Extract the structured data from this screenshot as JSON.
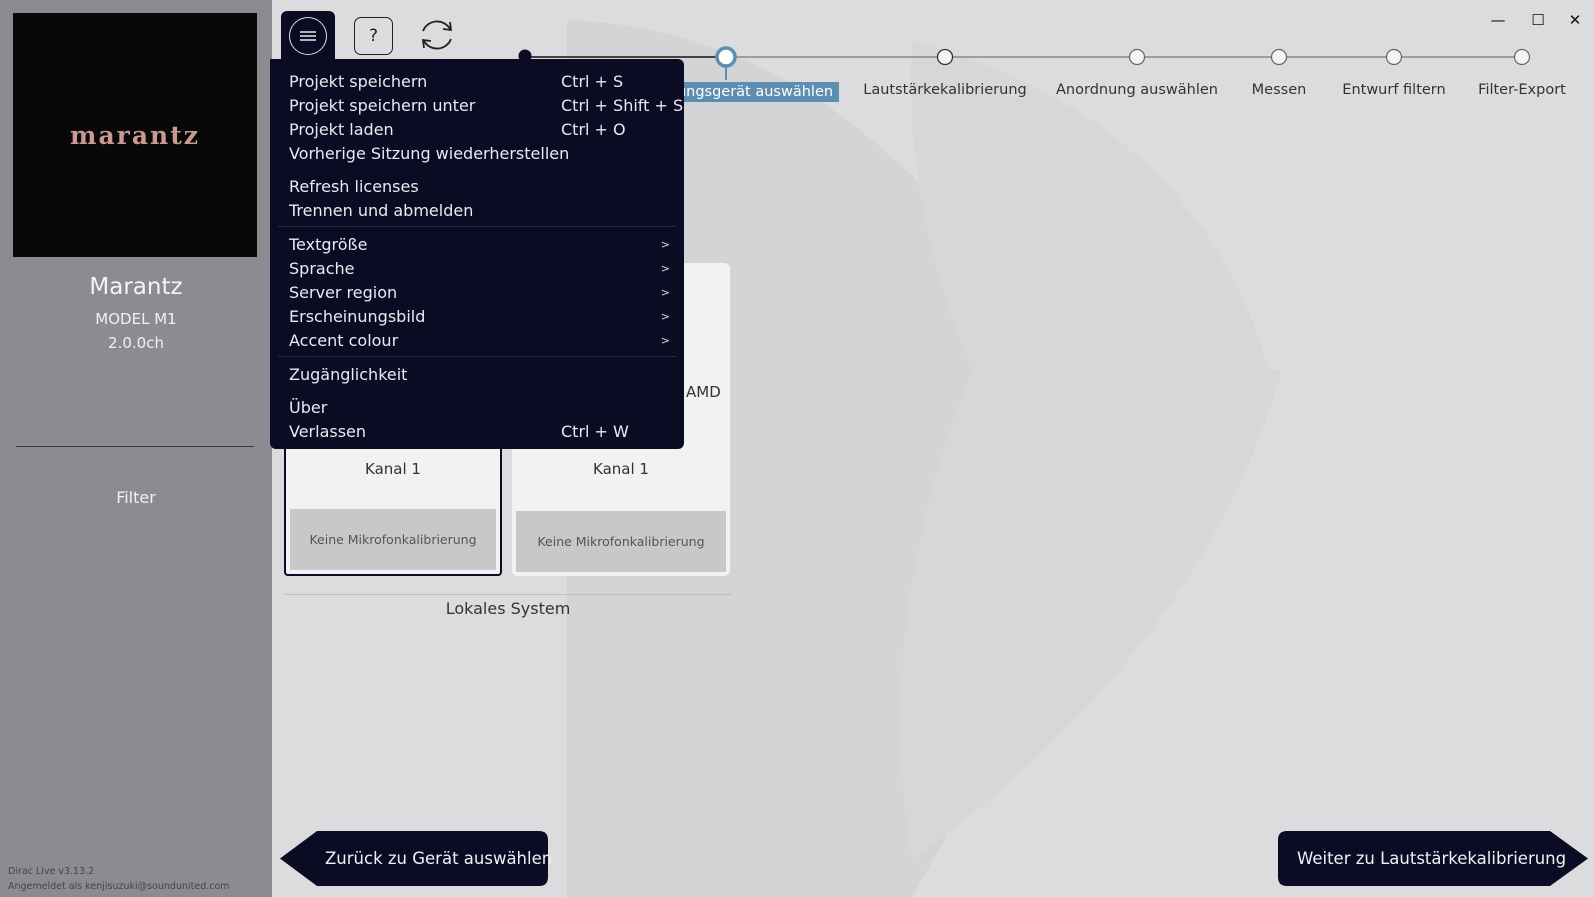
{
  "sidebar": {
    "brand_logo": "marantz",
    "device_name": "Marantz",
    "device_model": "MODEL M1",
    "device_channels": "2.0.0ch",
    "filter_label": "Filter",
    "version": "Dirac Live v3.13.2",
    "signed_in": "Angemeldet als kenjisuzuki@soundunited.com"
  },
  "toolbar": {
    "menu_icon": "hamburger-icon",
    "help_glyph": "?",
    "refresh_icon": "refresh-icon"
  },
  "window_controls": {
    "minimize": "—",
    "maximize": "☐",
    "close": "✕"
  },
  "steps": [
    {
      "label": "",
      "state": "done"
    },
    {
      "label": "ungsgerät auswählen",
      "state": "active"
    },
    {
      "label": "Lautstärkekalibrierung",
      "state": "pending"
    },
    {
      "label": "Anordnung auswählen",
      "state": "pending"
    },
    {
      "label": "Messen",
      "state": "pending"
    },
    {
      "label": "Entwurf filtern",
      "state": "pending"
    },
    {
      "label": "Filter-Export",
      "state": "pending"
    }
  ],
  "menu": {
    "items": [
      {
        "label": "Projekt speichern",
        "shortcut": "Ctrl + S"
      },
      {
        "label": "Projekt speichern unter",
        "shortcut": "Ctrl + Shift + S"
      },
      {
        "label": "Projekt laden",
        "shortcut": "Ctrl + O"
      },
      {
        "label": "Vorherige Sitzung wiederherstellen",
        "shortcut": ""
      },
      {
        "label": "Refresh licenses",
        "shortcut": ""
      },
      {
        "label": "Trennen und abmelden",
        "shortcut": ""
      },
      {
        "label": "Textgröße",
        "shortcut": ">"
      },
      {
        "label": "Sprache",
        "shortcut": ">"
      },
      {
        "label": "Server region",
        "shortcut": ">"
      },
      {
        "label": "Erscheinungsbild",
        "shortcut": ">"
      },
      {
        "label": "Accent colour",
        "shortcut": ">"
      },
      {
        "label": "Zugänglichkeit",
        "shortcut": ""
      },
      {
        "label": "Über",
        "shortcut": ""
      },
      {
        "label": "Verlassen",
        "shortcut": "Ctrl + W"
      }
    ]
  },
  "devices": [
    {
      "channel": "Kanal 1",
      "calibration": "Keine Mikrofonkalibrierung",
      "selected": true,
      "name_fragment": ""
    },
    {
      "channel": "Kanal 1",
      "calibration": "Keine Mikrofonkalibrierung",
      "selected": false,
      "name_fragment": "AMD"
    }
  ],
  "group_label": "Lokales System",
  "nav": {
    "back_label": "Zurück zu Gerät auswählen",
    "next_label": "Weiter zu Lautstärkekalibrierung"
  },
  "colors": {
    "menu_bg": "#0c0b24",
    "active_step": "#5e8db2",
    "sidebar_bg": "#8d8b92",
    "brand_text": "#c99a92"
  }
}
